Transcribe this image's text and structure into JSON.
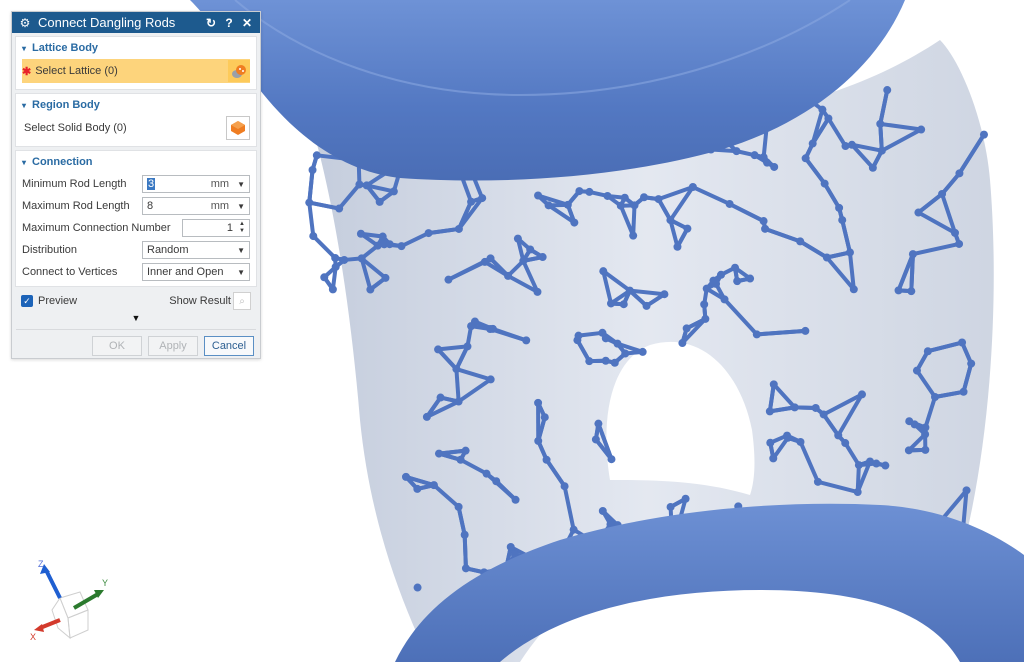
{
  "dialog": {
    "title": "Connect Dangling Rods",
    "title_icons": {
      "left": "gear-icon",
      "reset": "reset-icon",
      "help": "help-icon",
      "close": "close-icon"
    },
    "reset_glyph": "↻",
    "help_glyph": "?",
    "close_glyph": "✕",
    "gear_glyph": "⚙",
    "groups": {
      "lattice_body": {
        "header": "Lattice Body",
        "select_label": "Select Lattice (0)",
        "required_marker": "✱"
      },
      "region_body": {
        "header": "Region Body",
        "select_label": "Select Solid Body (0)"
      },
      "connection": {
        "header": "Connection",
        "min_rod_length": {
          "label": "Minimum Rod Length",
          "value": "3",
          "unit": "mm"
        },
        "max_rod_length": {
          "label": "Maximum Rod Length",
          "value": "8",
          "unit": "mm"
        },
        "max_connection_number": {
          "label": "Maximum Connection Number",
          "value": "1"
        },
        "distribution": {
          "label": "Distribution",
          "value": "Random"
        },
        "connect_to_vertices": {
          "label": "Connect to Vertices",
          "value": "Inner and Open"
        }
      }
    },
    "preview": {
      "label": "Preview",
      "checked": true
    },
    "show_result_label": "Show Result",
    "buttons": {
      "ok": "OK",
      "apply": "Apply",
      "cancel": "Cancel"
    },
    "collapse_tri": "▾",
    "more_tri": "▼"
  },
  "triad": {
    "x_label": "X",
    "y_label": "Y",
    "z_label": "Z"
  },
  "colors": {
    "title_bar": "#1d5a8e",
    "active_selection": "#fdd47c",
    "group_header": "#2a6ba3",
    "model_blue": "#5479c4",
    "ghost_body": "#c9d1df"
  }
}
